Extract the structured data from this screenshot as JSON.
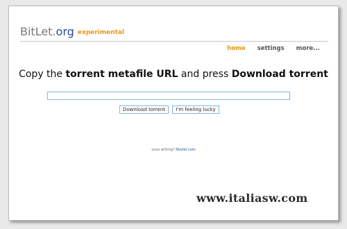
{
  "logo": {
    "bit": "BitLet",
    "dot": ".",
    "org": "org",
    "tag": "experimental"
  },
  "nav": {
    "home": "home",
    "settings": "settings",
    "more": "more..."
  },
  "instruction": {
    "part1": "Copy the ",
    "bold1": "torrent metafile URL",
    "part2": " and press ",
    "bold2": "Download torrent"
  },
  "url_input": {
    "value": "",
    "placeholder": ""
  },
  "buttons": {
    "download": "Download torrent",
    "lucky": "I'm feeling lucky"
  },
  "footer": {
    "text": "Love writing? ",
    "link": "Novlet.com"
  },
  "watermark": "www.italiasw.com"
}
